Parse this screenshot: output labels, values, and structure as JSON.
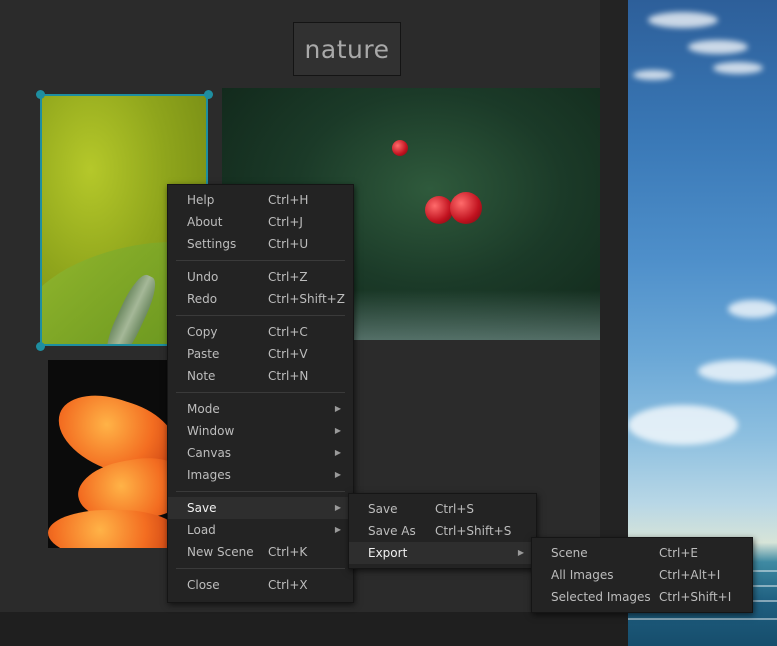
{
  "scene": {
    "title": "nature"
  },
  "context_menu": {
    "groups": [
      [
        {
          "label": "Help",
          "shortcut": "Ctrl+H"
        },
        {
          "label": "About",
          "shortcut": "Ctrl+J"
        },
        {
          "label": "Settings",
          "shortcut": "Ctrl+U"
        }
      ],
      [
        {
          "label": "Undo",
          "shortcut": "Ctrl+Z"
        },
        {
          "label": "Redo",
          "shortcut": "Ctrl+Shift+Z"
        }
      ],
      [
        {
          "label": "Copy",
          "shortcut": "Ctrl+C"
        },
        {
          "label": "Paste",
          "shortcut": "Ctrl+V"
        },
        {
          "label": "Note",
          "shortcut": "Ctrl+N"
        }
      ],
      [
        {
          "label": "Mode",
          "submenu": true
        },
        {
          "label": "Window",
          "submenu": true
        },
        {
          "label": "Canvas",
          "submenu": true
        },
        {
          "label": "Images",
          "submenu": true
        }
      ],
      [
        {
          "label": "Save",
          "submenu": true,
          "active": true
        },
        {
          "label": "Load",
          "submenu": true
        },
        {
          "label": "New Scene",
          "shortcut": "Ctrl+K"
        }
      ],
      [
        {
          "label": "Close",
          "shortcut": "Ctrl+X"
        }
      ]
    ]
  },
  "save_submenu": [
    {
      "label": "Save",
      "shortcut": "Ctrl+S"
    },
    {
      "label": "Save As",
      "shortcut": "Ctrl+Shift+S"
    },
    {
      "label": "Export",
      "submenu": true,
      "active": true
    }
  ],
  "export_submenu": [
    {
      "label": "Scene",
      "shortcut": "Ctrl+E"
    },
    {
      "label": "All Images",
      "shortcut": "Ctrl+Alt+I"
    },
    {
      "label": "Selected Images",
      "shortcut": "Ctrl+Shift+I"
    }
  ],
  "icons": {
    "submenu_arrow": "chevron-right-icon"
  },
  "colors": {
    "selection": "#1e8ea0",
    "menu_bg": "#232323",
    "canvas_bg": "#2b2b2b"
  }
}
